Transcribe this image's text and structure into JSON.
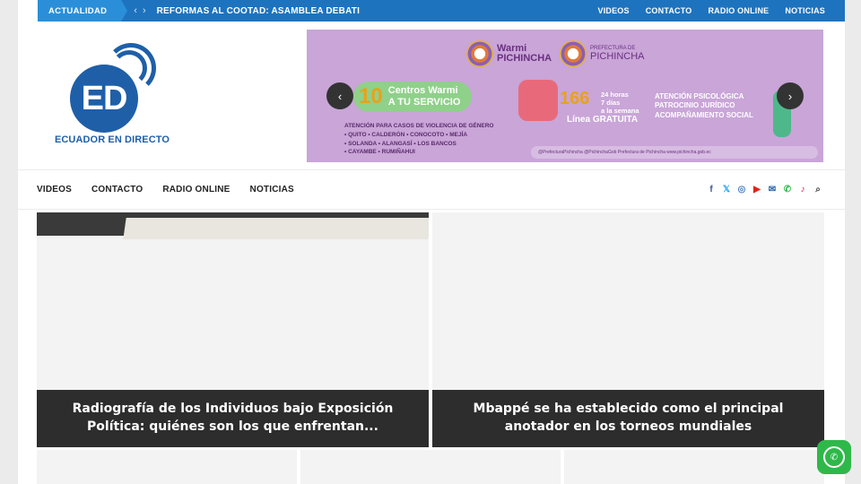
{
  "topbar": {
    "ticker_label": "ACTUALIDAD",
    "ticker_prev": "‹",
    "ticker_next": "›",
    "ticker_text": "REFORMAS AL COOTAD: ASAMBLEA DEBATI",
    "nav": [
      "VIDEOS",
      "CONTACTO",
      "RADIO ONLINE",
      "NOTICIAS"
    ]
  },
  "logo": {
    "mark": "ED",
    "name": "ECUADOR EN DIRECTO"
  },
  "banner": {
    "brand1_top": "Warmi",
    "brand1_bottom": "PICHINCHA",
    "brand2_top": "PREFECTURA DE",
    "brand2_bottom": "PICHINCHA",
    "pill_number": "10",
    "pill_line1": "Centros Warmi",
    "pill_line2": "A TU SERVICIO",
    "attention_title": "ATENCIÓN PARA CASOS DE VIOLENCIA DE GÉNERO",
    "locations_1": "• QUITO • CALDERÓN • CONOCOTO • MEJÍA",
    "locations_2": "• SOLANDA • ALANGASÍ • LOS BANCOS",
    "locations_3": "• CAYAMBE • RUMIÑAHUI",
    "hotline": "166",
    "hours_1": "24 horas",
    "hours_2": "7 días",
    "hours_3": "a la semana",
    "line": "Línea GRATUITA",
    "services_1": "ATENCIÓN PSICOLÓGICA",
    "services_2": "PATROCINIO JURÍDICO",
    "services_3": "ACOMPAÑAMIENTO SOCIAL",
    "footer": "@PrefecturaPichincha  @PichinchaGob  Prefectura de Pichincha  www.pichincha.gob.ec",
    "prev": "‹",
    "next": "›"
  },
  "nav": {
    "links": [
      "VIDEOS",
      "CONTACTO",
      "RADIO ONLINE",
      "NOTICIAS"
    ],
    "socials": [
      {
        "icon": "facebook-icon",
        "glyph": "f",
        "color": "#3b5998"
      },
      {
        "icon": "x-icon",
        "glyph": "𝕏",
        "color": "#1da1f2"
      },
      {
        "icon": "instagram-icon",
        "glyph": "◎",
        "color": "#4a7fbf"
      },
      {
        "icon": "youtube-icon",
        "glyph": "▶",
        "color": "#e62117"
      },
      {
        "icon": "email-icon",
        "glyph": "✉",
        "color": "#1f5fa8"
      },
      {
        "icon": "whatsapp-icon",
        "glyph": "✆",
        "color": "#2fb84a"
      },
      {
        "icon": "tiktok-icon",
        "glyph": "♪",
        "color": "#d9275f"
      },
      {
        "icon": "search-icon",
        "glyph": "⌕",
        "color": "#444444"
      }
    ]
  },
  "cards": [
    {
      "title": "Radiografía de los Individuos bajo Exposición Política: quiénes son los que enfrentan..."
    },
    {
      "title": "Mbappé se ha establecido como el principal anotador en los torneos mundiales"
    }
  ],
  "floating": {
    "whatsapp_glyph": "✆"
  }
}
